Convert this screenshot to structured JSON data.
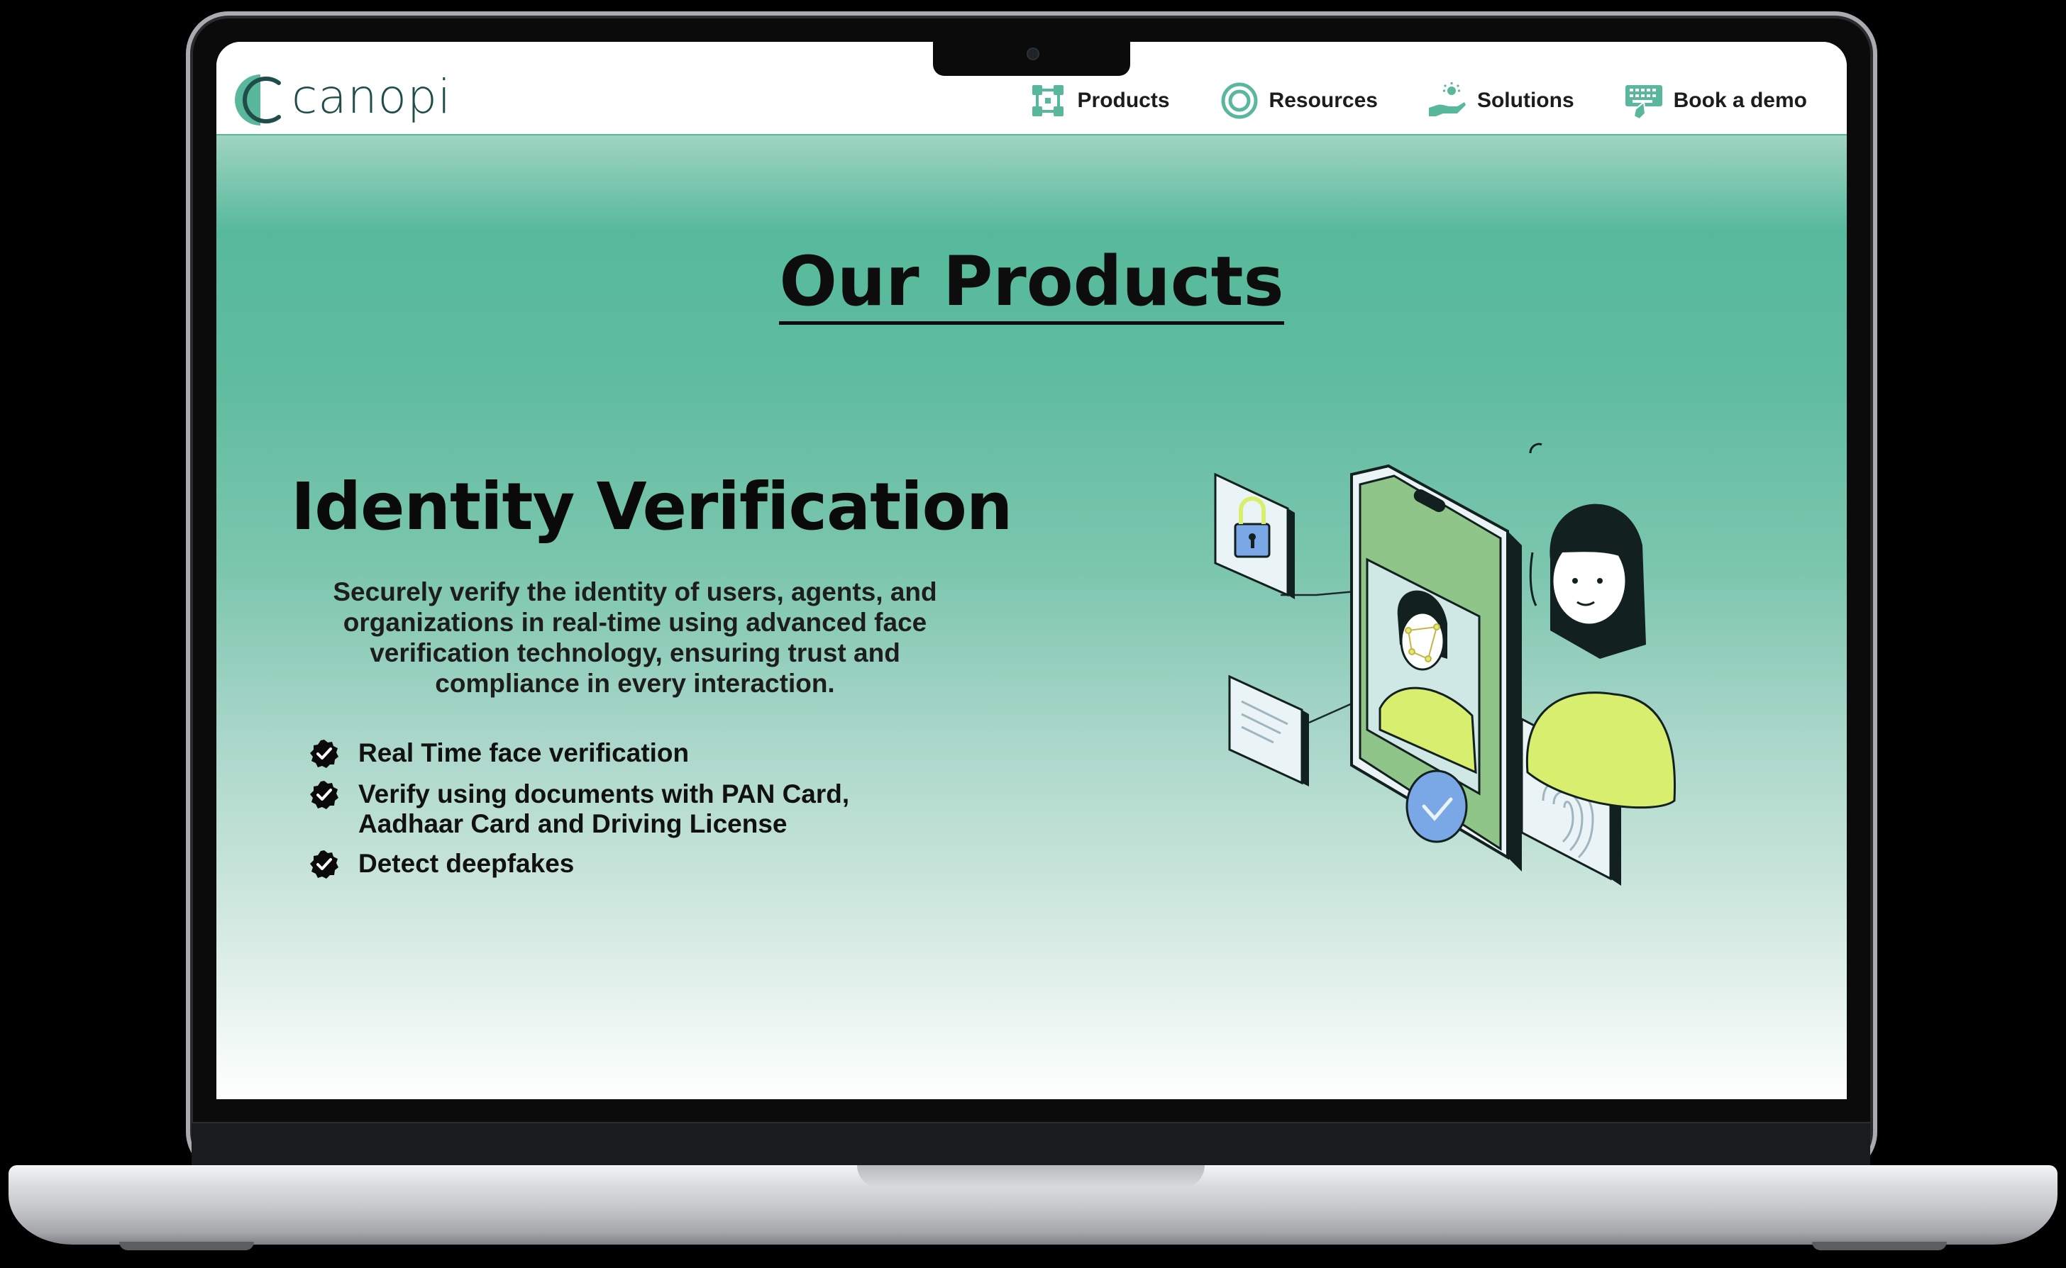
{
  "site": {
    "logo_text": "canopi",
    "colors": {
      "brand": "#59b89b",
      "accent": "#d7ee6e",
      "text": "#0d0d0d"
    }
  },
  "nav": {
    "items": [
      {
        "label": "Products",
        "icon": "products-icon"
      },
      {
        "label": "Resources",
        "icon": "resources-icon"
      },
      {
        "label": "Solutions",
        "icon": "solutions-icon"
      },
      {
        "label": "Book a demo",
        "icon": "book-demo-icon"
      }
    ]
  },
  "main": {
    "section_title": "Our Products",
    "product": {
      "title": "Identity Verification",
      "description": "Securely verify the identity of users, agents, and organizations in real-time using advanced face verification technology, ensuring trust and compliance in every interaction.",
      "features": [
        {
          "line1": "Real Time face verification",
          "line2": ""
        },
        {
          "line1": "Verify using documents with PAN Card,",
          "line2": "Aadhaar Card and Driving License"
        },
        {
          "line1": "Detect deepfakes",
          "line2": ""
        }
      ]
    },
    "illustration_icon": "identity-verification-illustration"
  }
}
